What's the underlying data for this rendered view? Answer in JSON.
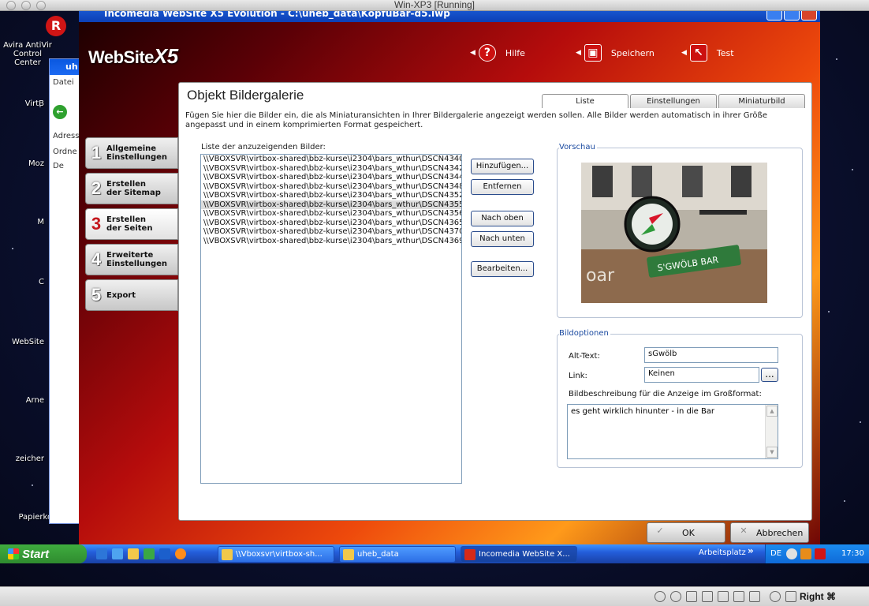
{
  "host": {
    "title": "Win-XP3 [Running]",
    "right_key": "Right ⌘"
  },
  "desktop": {
    "icons": [
      "Avira AntiVir Control Center",
      "VirtB",
      "Moz",
      "M",
      "C",
      "WebSite",
      "Arne",
      "zeicher",
      "Papierkorb"
    ]
  },
  "explorer": {
    "title": "uh",
    "menu": "Datei",
    "address": "Adress",
    "folder_label": "Ordne",
    "tree_root": "De"
  },
  "app": {
    "title": "Incomedia WebSite X5 Evolution - C:\\uheb_data\\KopfuBar-d5.iwp",
    "logo": "WebSite",
    "logo_suffix": "X5",
    "toolbar": {
      "help": "Hilfe",
      "save": "Speichern",
      "test": "Test"
    },
    "steps": [
      {
        "num": "1",
        "label": "Allgemeine Einstellungen"
      },
      {
        "num": "2",
        "label": "Erstellen der Sitemap"
      },
      {
        "num": "3",
        "label": "Erstellen der Seiten"
      },
      {
        "num": "4",
        "label": "Erweiterte Einstellungen"
      },
      {
        "num": "5",
        "label": "Export"
      }
    ],
    "panel": {
      "title": "Objekt Bildergalerie",
      "tabs": [
        "Liste",
        "Einstellungen",
        "Miniaturbild"
      ],
      "description": "Fügen Sie hier die Bilder ein, die als Miniaturansichten in Ihrer Bildergalerie angezeigt werden sollen. Alle Bilder werden automatisch in ihrer Größe angepasst und in einem komprimierten Format gespeichert.",
      "list_label": "Liste der anzuzeigenden Bilder:",
      "files": [
        "\\\\VBOXSVR\\virtbox-shared\\bbz-kurse\\i2304\\bars_wthur\\DSCN4340.jpg",
        "\\\\VBOXSVR\\virtbox-shared\\bbz-kurse\\i2304\\bars_wthur\\DSCN4342.jpg",
        "\\\\VBOXSVR\\virtbox-shared\\bbz-kurse\\i2304\\bars_wthur\\DSCN4344.jpg",
        "\\\\VBOXSVR\\virtbox-shared\\bbz-kurse\\i2304\\bars_wthur\\DSCN4348.jpg",
        "\\\\VBOXSVR\\virtbox-shared\\bbz-kurse\\i2304\\bars_wthur\\DSCN4352.jpg",
        "\\\\VBOXSVR\\virtbox-shared\\bbz-kurse\\i2304\\bars_wthur\\DSCN4355.jpg",
        "\\\\VBOXSVR\\virtbox-shared\\bbz-kurse\\i2304\\bars_wthur\\DSCN4356.jpg",
        "\\\\VBOXSVR\\virtbox-shared\\bbz-kurse\\i2304\\bars_wthur\\DSCN4365.jpg",
        "\\\\VBOXSVR\\virtbox-shared\\bbz-kurse\\i2304\\bars_wthur\\DSCN4370.jpg",
        "\\\\VBOXSVR\\virtbox-shared\\bbz-kurse\\i2304\\bars_wthur\\DSCN4369.jpg"
      ],
      "selected_index": 5,
      "buttons": {
        "add": "Hinzufügen...",
        "remove": "Entfernen",
        "up": "Nach oben",
        "down": "Nach unten",
        "edit": "Bearbeiten..."
      },
      "preview_label": "Vorschau",
      "options_label": "Bildoptionen",
      "alt_label": "Alt-Text:",
      "alt_value": "sGwölb",
      "link_label": "Link:",
      "link_value": "Keinen",
      "link_button": "...",
      "desc_label": "Bildbeschreibung für die Anzeige im Großformat:",
      "desc_value": "es geht wirklich hinunter - in die Bar"
    },
    "ok": "OK",
    "cancel": "Abbrechen"
  },
  "taskbar": {
    "start": "Start",
    "tasks": [
      "\\\\Vboxsvr\\virtbox-sh...",
      "uheb_data",
      "Incomedia WebSite X..."
    ],
    "toolbar_label": "Arbeitsplatz",
    "lang": "DE",
    "time": "17:30"
  },
  "colors": {
    "accent": "#c4161c",
    "xp_blue": "#245edb",
    "start_green": "#3a9e3a"
  }
}
